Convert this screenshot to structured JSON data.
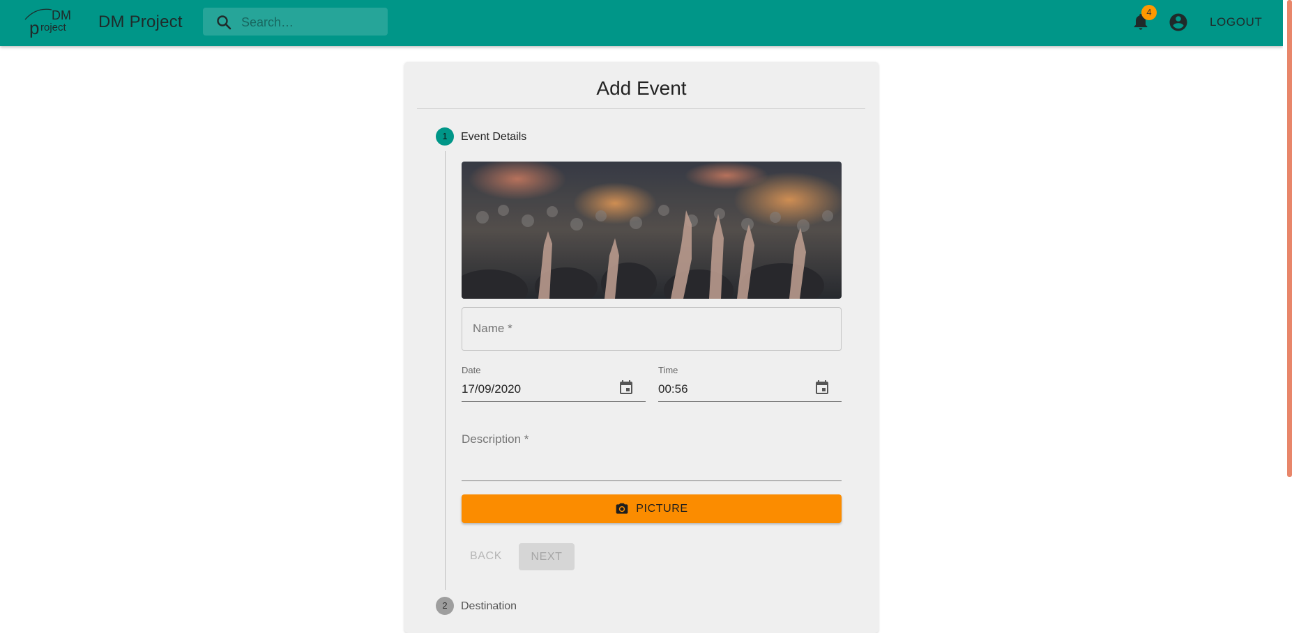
{
  "app": {
    "title": "DM Project",
    "logo_text_top": "DM",
    "logo_text_bottom": "project",
    "search_placeholder": "Search…",
    "notifications_count": "4",
    "logout_label": "LOGOUT",
    "primary_color": "#009688",
    "accent_color": "#ff9800"
  },
  "form": {
    "title": "Add Event",
    "steps": [
      {
        "number": "1",
        "label": "Event Details",
        "active": true
      },
      {
        "number": "2",
        "label": "Destination",
        "active": false
      }
    ],
    "image_description": "concert crowd with raised hands",
    "name_placeholder": "Name *",
    "date_label": "Date",
    "date_value": "17/09/2020",
    "time_label": "Time",
    "time_value": "00:56",
    "description_placeholder": "Description *",
    "picture_label": "PICTURE",
    "back_label": "BACK",
    "next_label": "NEXT"
  },
  "icons": {
    "search": "search-icon",
    "notifications": "bell-icon",
    "account": "account-circle-icon",
    "calendar": "calendar-icon",
    "camera": "camera-icon"
  }
}
